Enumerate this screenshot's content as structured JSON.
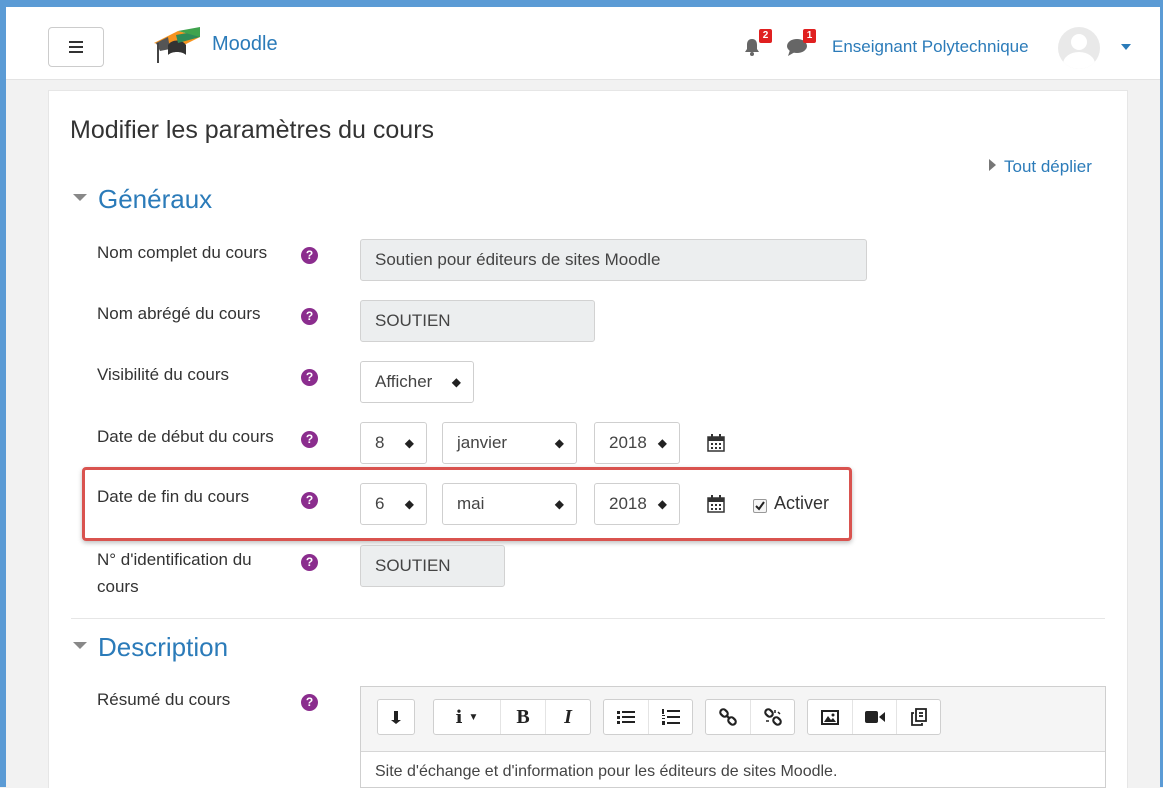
{
  "navbar": {
    "brand": "Moodle",
    "notifications_count": "2",
    "messages_count": "1",
    "user_name": "Enseignant Polytechnique"
  },
  "page": {
    "title": "Modifier les paramètres du cours",
    "expand_all": "Tout déplier"
  },
  "sections": {
    "general": "Généraux",
    "description": "Description"
  },
  "fields": {
    "fullname": {
      "label": "Nom complet du cours",
      "value": "Soutien pour éditeurs de sites Moodle"
    },
    "shortname": {
      "label": "Nom abrégé du cours",
      "value": "SOUTIEN"
    },
    "visibility": {
      "label": "Visibilité du cours",
      "value": "Afficher"
    },
    "startdate": {
      "label": "Date de début du cours",
      "day": "8",
      "month": "janvier",
      "year": "2018"
    },
    "enddate": {
      "label": "Date de fin du cours",
      "day": "6",
      "month": "mai",
      "year": "2018",
      "enable_label": "Activer",
      "enabled": true
    },
    "idnumber": {
      "label_line1": "N° d'identification du",
      "label_line2": "cours",
      "value": "SOUTIEN"
    },
    "summary": {
      "label": "Résumé du cours",
      "value": "Site d'échange et d'information pour les éditeurs de sites Moodle."
    }
  },
  "editor_toolbar": {
    "bold": "B",
    "italic": "I",
    "buttons": [
      "collapse-icon",
      "paragraph-styles-icon",
      "bold-icon",
      "italic-icon",
      "unordered-list-icon",
      "ordered-list-icon",
      "link-icon",
      "unlink-icon",
      "image-icon",
      "video-icon",
      "manage-files-icon"
    ]
  },
  "colors": {
    "link": "#2b7bb9",
    "help": "#8b2d8e",
    "highlight": "#d9534f",
    "badge": "#e02020",
    "frame": "#5b9bd5"
  }
}
